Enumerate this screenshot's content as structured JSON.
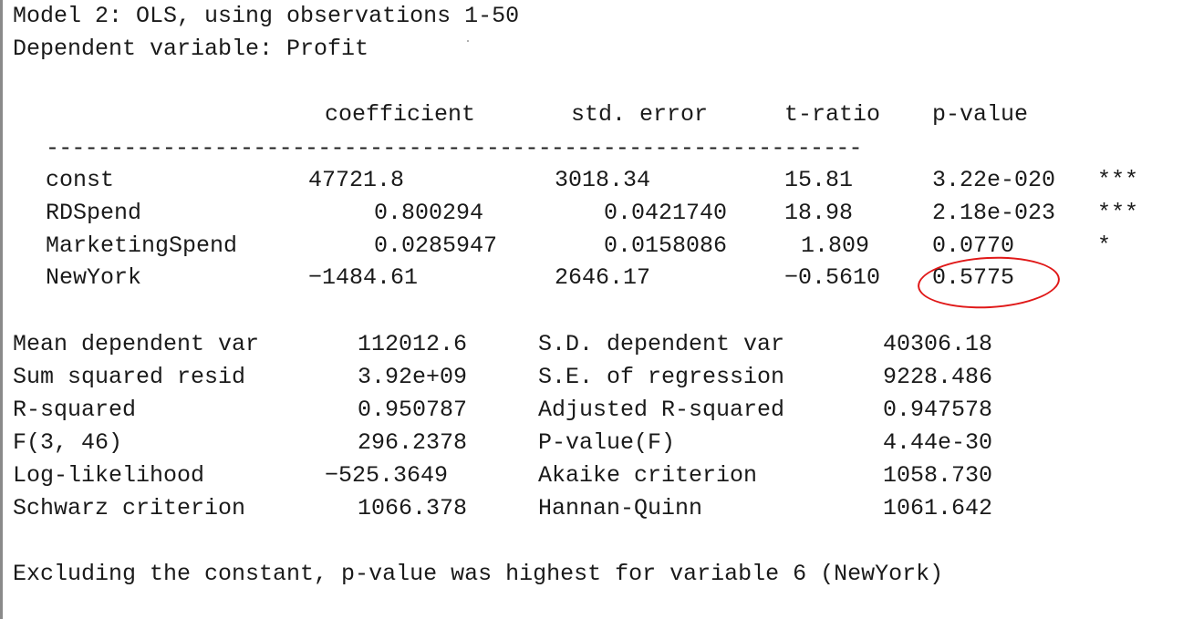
{
  "header": {
    "model_line": "Model 2: OLS, using observations 1-50",
    "dependent_line": "Dependent variable: Profit"
  },
  "table": {
    "columns": [
      "coefficient",
      "std. error",
      "t-ratio",
      "p-value"
    ],
    "separator": "---------------------------------------------------------------",
    "rows": [
      {
        "name": "const",
        "coef": "47721.8",
        "se": "3018.34",
        "t": "15.81",
        "p": "3.22e-020",
        "stars": "***"
      },
      {
        "name": "RDSpend",
        "coef": "0.800294",
        "se": "0.0421740",
        "t": "18.98",
        "p": "2.18e-023",
        "stars": "***"
      },
      {
        "name": "MarketingSpend",
        "coef": "0.0285947",
        "se": "0.0158086",
        "t": "1.809",
        "p": "0.0770",
        "stars": "*"
      },
      {
        "name": "NewYork",
        "coef": "−1484.61",
        "se": "2646.17",
        "t": "−0.5610",
        "p": "0.5775",
        "stars": ""
      }
    ]
  },
  "stats": [
    {
      "l1": "Mean dependent var",
      "v1": "112012.6",
      "l2": "S.D. dependent var",
      "v2": "40306.18"
    },
    {
      "l1": "Sum squared resid",
      "v1": "3.92e+09",
      "l2": "S.E. of regression",
      "v2": "9228.486"
    },
    {
      "l1": "R-squared",
      "v1": "0.950787",
      "l2": "Adjusted R-squared",
      "v2": "0.947578"
    },
    {
      "l1": "F(3, 46)",
      "v1": "296.2378",
      "l2": "P-value(F)",
      "v2": "4.44e-30"
    },
    {
      "l1": "Log-likelihood",
      "v1": "−525.3649",
      "l2": "Akaike criterion",
      "v2": "1058.730"
    },
    {
      "l1": "Schwarz criterion",
      "v1": "1066.378",
      "l2": "Hannan-Quinn",
      "v2": "1061.642"
    }
  ],
  "footer": "Excluding the constant, p-value was highest for variable 6 (NewYork)",
  "colors": {
    "highlight_circle": "#e01818"
  }
}
